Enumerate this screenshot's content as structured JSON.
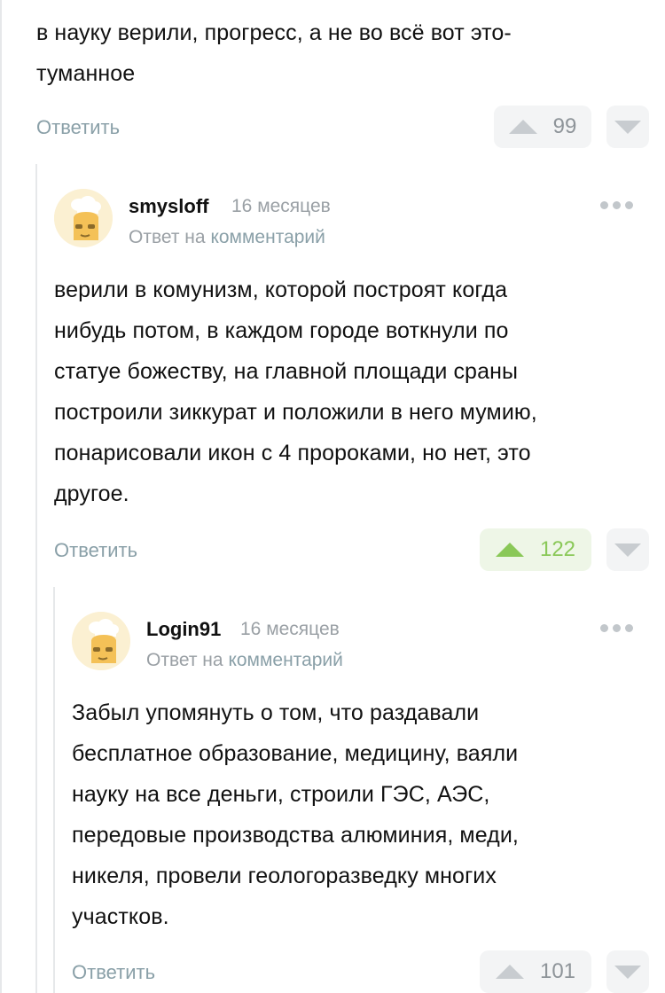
{
  "comment0": {
    "text_lines": [
      "в науку верили, прогресс, а не во всё вот это-",
      "туманное"
    ],
    "reply_label": "Ответить",
    "upvotes": "99"
  },
  "comment1": {
    "username": "smysloff",
    "time": "16 месяцев",
    "reply_prefix": "Ответ на",
    "reply_target": "комментарий",
    "text_lines": [
      "верили в комунизм, которой построят когда",
      "нибудь потом,  в каждом городе воткнули по",
      "статуе божеству, на главной площади сраны",
      "построили зиккурат и положили в него мумию,",
      "понарисовали икон с 4 пророками, но нет, это",
      "другое."
    ],
    "reply_label": "Ответить",
    "upvotes": "122"
  },
  "comment2": {
    "username": "Login91",
    "time": "16 месяцев",
    "reply_prefix": "Ответ на",
    "reply_target": "комментарий",
    "text_lines": [
      "Забыл упомянуть о том, что раздавали",
      "бесплатное образование, медицину, ваяли",
      "науку на все деньги, строили ГЭС, АЭС,",
      "передовые производства алюминия, меди,",
      "никеля, провели геологоразведку многих",
      "участков."
    ],
    "reply_label": "Ответить",
    "upvotes": "101"
  },
  "colors": {
    "accent_green": "#8ac858",
    "link_gray": "#8aa0a8",
    "thread_line": "#e6e8ea"
  },
  "icons": [
    "more-dots-icon",
    "upvote-arrow-icon",
    "downvote-arrow-icon",
    "chef-avatar-icon"
  ]
}
